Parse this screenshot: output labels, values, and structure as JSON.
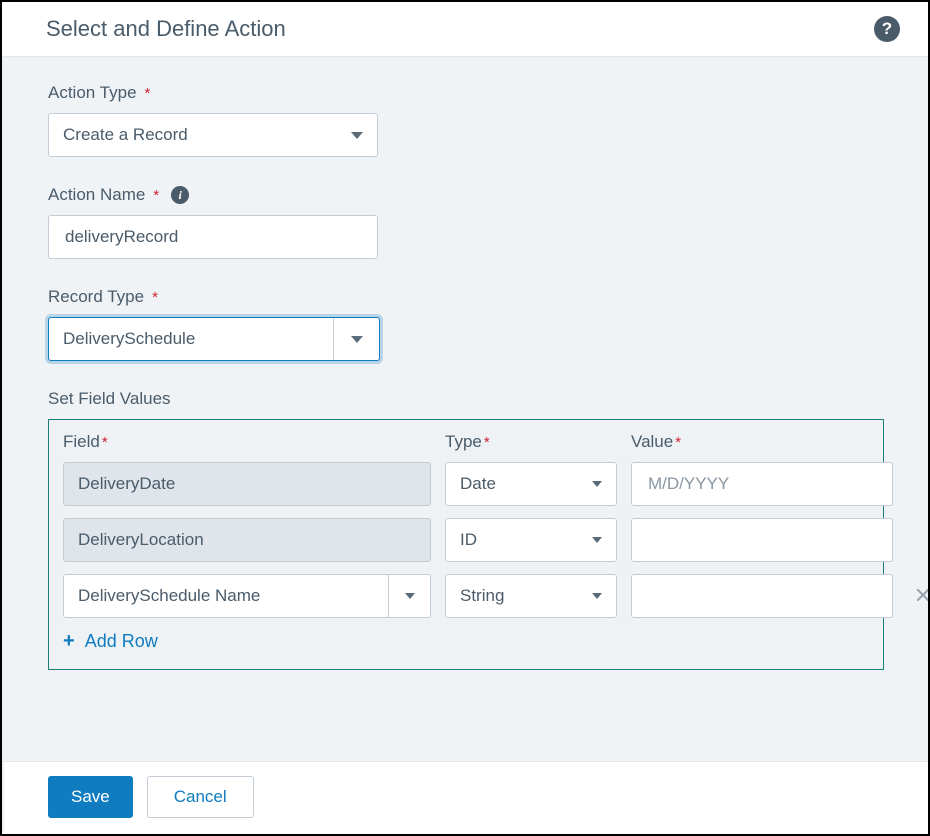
{
  "header": {
    "title": "Select and Define Action",
    "help_glyph": "?"
  },
  "labels": {
    "action_type": "Action Type",
    "action_name": "Action Name",
    "record_type": "Record Type",
    "set_field_values": "Set Field Values",
    "required": "*",
    "info_glyph": "i"
  },
  "action_type": {
    "value": "Create a Record"
  },
  "action_name": {
    "value": "deliveryRecord"
  },
  "record_type": {
    "value": "DeliverySchedule"
  },
  "table": {
    "headers": {
      "field": "Field",
      "type": "Type",
      "value": "Value"
    },
    "rows": [
      {
        "field": "DeliveryDate",
        "field_readonly": true,
        "field_has_caret": false,
        "type": "Date",
        "value": "",
        "value_placeholder": "M/D/YYYY",
        "removable": false
      },
      {
        "field": "DeliveryLocation",
        "field_readonly": true,
        "field_has_caret": false,
        "type": "ID",
        "value": "",
        "value_placeholder": "",
        "removable": false
      },
      {
        "field": "DeliverySchedule Name",
        "field_readonly": false,
        "field_has_caret": true,
        "type": "String",
        "value": "",
        "value_placeholder": "",
        "removable": true
      }
    ],
    "add_row_label": "Add Row",
    "add_row_glyph": "+",
    "remove_glyph": "✕"
  },
  "footer": {
    "save": "Save",
    "cancel": "Cancel"
  }
}
